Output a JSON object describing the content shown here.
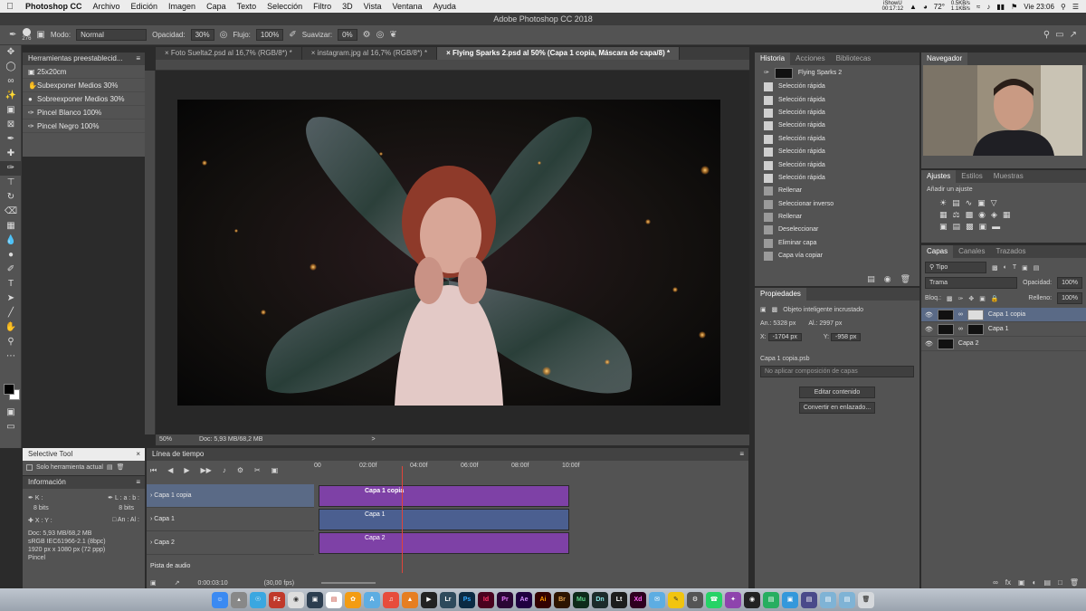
{
  "menubar": {
    "app_name": "Photoshop CC",
    "items": [
      "Archivo",
      "Edición",
      "Imagen",
      "Capa",
      "Texto",
      "Selección",
      "Filtro",
      "3D",
      "Vista",
      "Ventana",
      "Ayuda"
    ],
    "status_iShowU": "iShowU",
    "status_timer": "00:17:12",
    "status_net_up": "0.5KB/s",
    "status_net_down": "1.1KB/s",
    "temperature": "72°",
    "clock": "Vie 23:06"
  },
  "window_title": "Adobe Photoshop CC 2018",
  "options_bar": {
    "brush_size": "276",
    "mode_label": "Modo:",
    "mode_value": "Normal",
    "opacity_label": "Opacidad:",
    "opacity_value": "30%",
    "flow_label": "Flujo:",
    "flow_value": "100%",
    "smoothing_label": "Suavizar:",
    "smoothing_value": "0%"
  },
  "presets_panel": {
    "title": "Herramientas preestablecid...",
    "items": [
      "25x20cm",
      "Subexponer Medios 30%",
      "Sobreexponer Medios 30%",
      "Pincel Blanco 100%",
      "Pincel Negro 100%"
    ]
  },
  "doc_tabs": [
    "Foto Suelta2.psd al 16,7% (RGB/8*) *",
    "instagram.jpg al 16,7% (RGB/8*) *",
    "Flying Sparks 2.psd al 50% (Capa 1 copia, Máscara de capa/8) *"
  ],
  "canvas_status": {
    "zoom": "50%",
    "doc": "Doc: 5,93 MB/68,2 MB",
    "arrow": ">"
  },
  "history_panel": {
    "tabs": [
      "Historia",
      "Acciones",
      "Bibliotecas"
    ],
    "snapshot": "Flying Sparks 2",
    "items": [
      "Selección rápida",
      "Selección rápida",
      "Selección rápida",
      "Selección rápida",
      "Selección rápida",
      "Selección rápida",
      "Selección rápida",
      "Selección rápida",
      "Rellenar",
      "Seleccionar inverso",
      "Rellenar",
      "Deseleccionar",
      "Eliminar capa",
      "Capa vía copiar"
    ]
  },
  "properties_panel": {
    "title": "Propiedades",
    "type": "Objeto inteligente incrustado",
    "an_label": "An.:",
    "an_value": "5328 px",
    "al_label": "Al.:",
    "al_value": "2997 px",
    "x_label": "X:",
    "x_value": "-1704 px",
    "y_label": "Y:",
    "y_value": "-958 px",
    "file": "Capa 1 copia.psb",
    "comp": "No aplicar composición de capas",
    "edit_button": "Editar contenido",
    "convert_button": "Convertir en enlazado..."
  },
  "navigator": {
    "title": "Navegador"
  },
  "adjustments_panel": {
    "tabs": [
      "Ajustes",
      "Estilos",
      "Muestras"
    ],
    "add_label": "Añadir un ajuste"
  },
  "layers_panel": {
    "tabs": [
      "Capas",
      "Canales",
      "Trazados"
    ],
    "filter": "Tipo",
    "blend_mode": "Trama",
    "opacity_label": "Opacidad:",
    "opacity_value": "100%",
    "lock_label": "Bloq.:",
    "fill_label": "Relleno:",
    "fill_value": "100%",
    "layers": [
      "Capa 1 copia",
      "Capa 1",
      "Capa 2"
    ]
  },
  "timeline": {
    "title": "Línea de tiempo",
    "ruler": [
      "00",
      "02:00f",
      "04:00f",
      "06:00f",
      "08:00f",
      "10:00f"
    ],
    "tracks": [
      "Capa 1 copia",
      "Capa 1",
      "Capa 2"
    ],
    "audio_track": "Pista de audio",
    "current_time": "0:00:03:10",
    "fps": "(30,00 fps)"
  },
  "selective_tool": {
    "title": "Selective Tool",
    "checkbox": "Solo herramienta actual"
  },
  "info_panel": {
    "title": "Información",
    "k_label": "K :",
    "l_label": "L :",
    "a_label": "a :",
    "b_label": "b :",
    "bits_left": "8 bits",
    "bits_right": "8 bits",
    "x_label": "X :",
    "y_label": "Y :",
    "an_label": "An :",
    "al_label": "Al :",
    "doc": "Doc: 5,93 MB/68,2 MB",
    "profile": "sRGB IEC61966-2.1 (8bpc)",
    "dims": "1920 px x 1080 px (72 ppp)",
    "tool": "Pincel"
  },
  "dock_apps": [
    "Lr",
    "Ps",
    "Id",
    "Pr",
    "Ae",
    "Ai",
    "Br",
    "Mu",
    "Dn",
    "Lt",
    "Xd"
  ]
}
